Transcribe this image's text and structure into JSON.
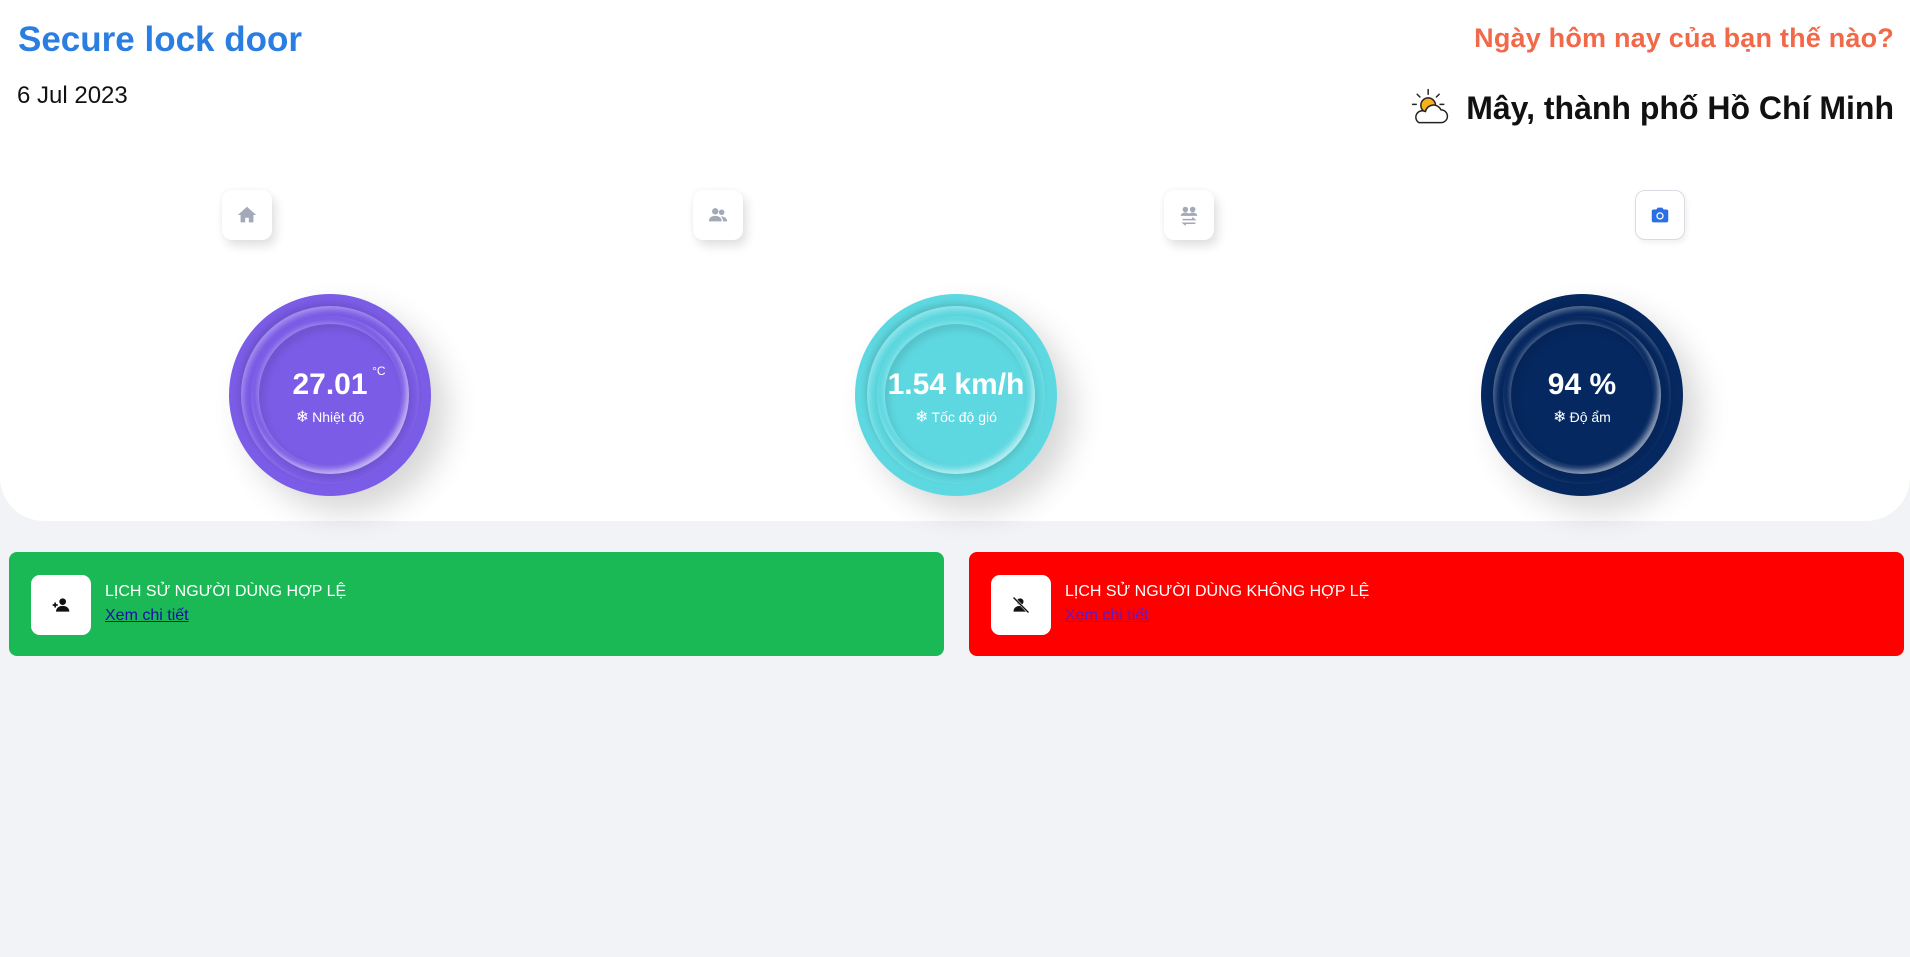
{
  "header": {
    "title": "Secure lock door",
    "date": "6 Jul 2023",
    "greeting": "Ngày hôm nay của bạn thế nào?",
    "weather_icon": "partly-cloudy-icon",
    "weather_text": "Mây, thành phố Hồ Chí Minh"
  },
  "nav": [
    {
      "icon": "home-icon",
      "active": false
    },
    {
      "icon": "users-icon",
      "active": false
    },
    {
      "icon": "user-swap-icon",
      "active": false
    },
    {
      "icon": "camera-icon",
      "active": true
    }
  ],
  "gauges": {
    "temperature": {
      "value": "27.01",
      "unit": "°C",
      "label": "Nhiệt độ",
      "color": "#7b5ce6"
    },
    "wind": {
      "value": "1.54 km/h",
      "label": "Tốc độ gió",
      "color": "#5ed8e0"
    },
    "humidity": {
      "value": "94 %",
      "label": "Độ ẩm",
      "color": "#062860"
    }
  },
  "cards": {
    "valid": {
      "title": "LỊCH SỬ NGƯỜI DÙNG HỢP LỆ",
      "link": "Xem chi tiết",
      "color": "#1bb956"
    },
    "invalid": {
      "title": "LỊCH SỬ NGƯỜI DÙNG KHÔNG HỢP LỆ",
      "link": "Xem chi tiết",
      "color": "#ff0000"
    }
  },
  "colors": {
    "accent": "#2a7de1",
    "greeting": "#f2694a",
    "icon_inactive": "#a3a9b8",
    "icon_active": "#2a6fe3",
    "background": "#f2f3f6"
  }
}
